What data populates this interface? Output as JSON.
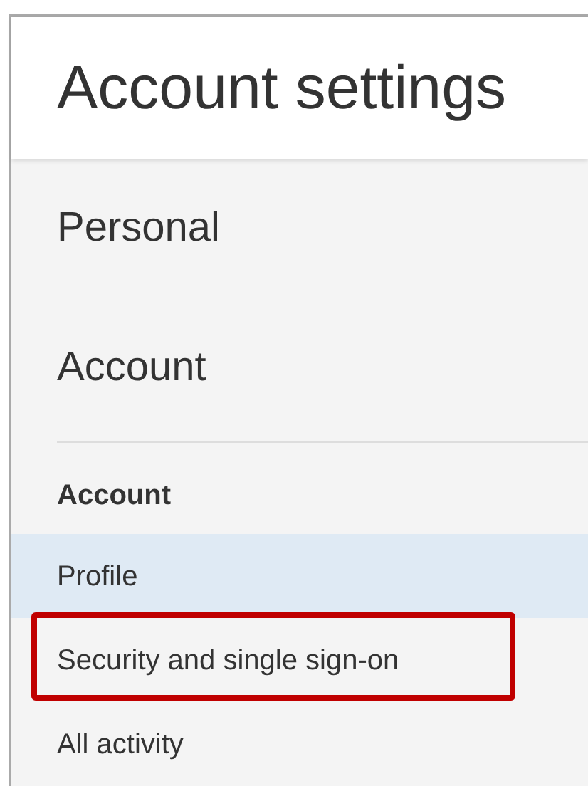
{
  "header": {
    "title": "Account settings"
  },
  "sections": [
    {
      "label": "Personal"
    },
    {
      "label": "Account"
    }
  ],
  "group": {
    "heading": "Account",
    "items": [
      {
        "label": "Profile",
        "selected": true,
        "highlighted": false
      },
      {
        "label": "Security and single sign-on",
        "selected": false,
        "highlighted": true
      },
      {
        "label": "All activity",
        "selected": false,
        "highlighted": false
      }
    ]
  }
}
